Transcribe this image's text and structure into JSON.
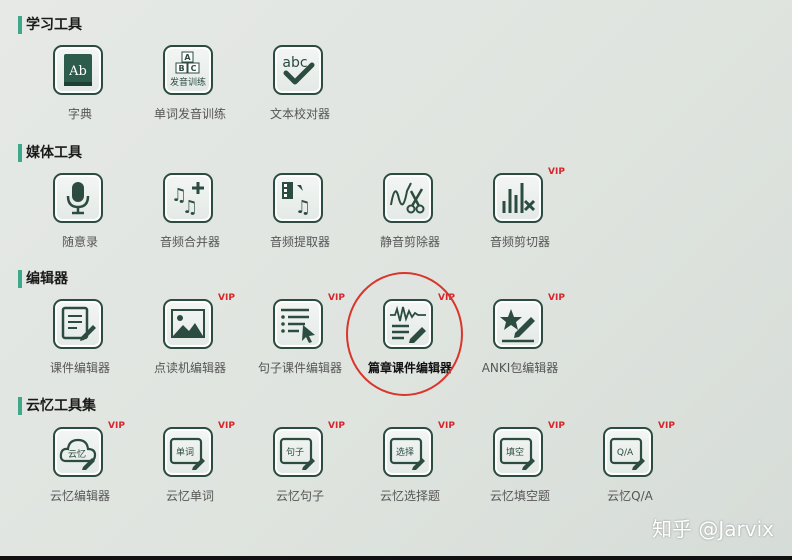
{
  "colors": {
    "accent": "#3fa88a",
    "icon_dark": "#2d4c41",
    "vip_red": "#d7262b",
    "highlight_circle": "#d9352b"
  },
  "sections": {
    "study": {
      "title": "学习工具",
      "tools": [
        {
          "label": "字典",
          "icon": "dictionary-icon",
          "vip": false
        },
        {
          "label": "单词发音训练",
          "icon": "word-pronunciation-icon",
          "vip": false,
          "icon_text": [
            "A",
            "B",
            "C",
            "发音训练"
          ]
        },
        {
          "label": "文本校对器",
          "icon": "text-proofread-icon",
          "vip": false,
          "icon_text": "abc"
        }
      ]
    },
    "media": {
      "title": "媒体工具",
      "tools": [
        {
          "label": "随意录",
          "icon": "microphone-icon",
          "vip": false
        },
        {
          "label": "音频合并器",
          "icon": "audio-merge-icon",
          "vip": false
        },
        {
          "label": "音频提取器",
          "icon": "audio-extract-icon",
          "vip": false
        },
        {
          "label": "静音剪除器",
          "icon": "silence-cut-icon",
          "vip": false
        },
        {
          "label": "音频剪切器",
          "icon": "audio-cut-icon",
          "vip": true
        }
      ]
    },
    "editor": {
      "title": "编辑器",
      "tools": [
        {
          "label": "课件编辑器",
          "icon": "courseware-edit-icon",
          "vip": false
        },
        {
          "label": "点读机编辑器",
          "icon": "image-reader-icon",
          "vip": true
        },
        {
          "label": "句子课件编辑器",
          "icon": "sentence-list-icon",
          "vip": true
        },
        {
          "label": "篇章课件编辑器",
          "icon": "passage-edit-icon",
          "vip": true,
          "highlighted": true
        },
        {
          "label": "ANKI包编辑器",
          "icon": "anki-star-icon",
          "vip": true
        }
      ]
    },
    "cloud": {
      "title": "云忆工具集",
      "tools": [
        {
          "label": "云忆编辑器",
          "icon": "cloud-edit-icon",
          "vip": true,
          "icon_text": "云忆"
        },
        {
          "label": "云忆单词",
          "icon": "cloud-word-icon",
          "vip": true,
          "icon_text": "单词"
        },
        {
          "label": "云忆句子",
          "icon": "cloud-sentence-icon",
          "vip": true,
          "icon_text": "句子"
        },
        {
          "label": "云忆选择题",
          "icon": "cloud-choice-icon",
          "vip": true,
          "icon_text": "选择"
        },
        {
          "label": "云忆填空题",
          "icon": "cloud-fill-icon",
          "vip": true,
          "icon_text": "填空"
        },
        {
          "label": "云忆Q/A",
          "icon": "cloud-qa-icon",
          "vip": true,
          "icon_text": "Q/A"
        }
      ]
    }
  },
  "vip_badge": "VIP",
  "watermark": "知乎 @Jarvix"
}
